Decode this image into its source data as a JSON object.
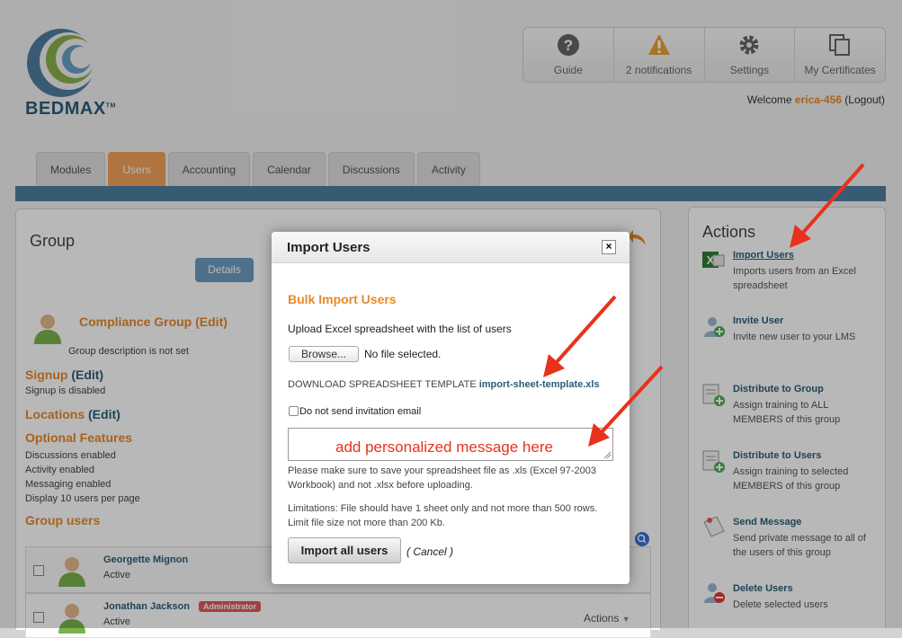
{
  "logo": {
    "text": "BEDMAX",
    "tm": "TM"
  },
  "topnav": [
    {
      "label": "Guide",
      "icon": "question-icon"
    },
    {
      "label": "2 notifications",
      "icon": "warning-icon"
    },
    {
      "label": "Settings",
      "icon": "gear-icon"
    },
    {
      "label": "My Certificates",
      "icon": "certificates-icon"
    }
  ],
  "welcome": {
    "prefix": "Welcome ",
    "user": "erica-456",
    "logout": "(Logout)"
  },
  "tabs": [
    "Modules",
    "Users",
    "Accounting",
    "Calendar",
    "Discussions",
    "Activity"
  ],
  "active_tab": "Users",
  "group": {
    "title": "Group",
    "details_button": "Details",
    "name": "Compliance Group",
    "edit": "(Edit)",
    "description": "Group description is not set",
    "signup_title": "Signup",
    "signup_edit": "(Edit)",
    "signup_status": "Signup is disabled",
    "locations_title": "Locations",
    "locations_edit": "(Edit)",
    "optional_title": "Optional Features",
    "features": [
      "Discussions enabled",
      "Activity enabled",
      "Messaging enabled",
      "Display 10 users per page"
    ],
    "users_title": "Group users",
    "users": [
      {
        "name": "Georgette Mignon",
        "status": "Active",
        "badge": ""
      },
      {
        "name": "Jonathan Jackson",
        "status": "Active",
        "badge": "Administrator"
      }
    ],
    "row_actions": "Actions"
  },
  "actions": {
    "title": "Actions",
    "items": [
      {
        "title": "Import Users",
        "desc": "Imports users from an Excel spreadsheet",
        "icon": "excel-icon"
      },
      {
        "title": "Invite User",
        "desc": "Invite new user to your LMS",
        "icon": "invite-user-icon"
      },
      {
        "title": "Distribute to Group",
        "desc": "Assign training to ALL MEMBERS of this group",
        "icon": "distribute-group-icon"
      },
      {
        "title": "Distribute to Users",
        "desc": "Assign training to selected MEMBERS of this group",
        "icon": "distribute-users-icon"
      },
      {
        "title": "Send Message",
        "desc": "Send private message to all of the users of this group",
        "icon": "message-icon"
      },
      {
        "title": "Delete Users",
        "desc": "Delete selected users",
        "icon": "delete-users-icon"
      }
    ]
  },
  "modal": {
    "title": "Import Users",
    "close": "×",
    "subtitle": "Bulk Import Users",
    "upload_label": "Upload Excel spreadsheet with the list of users",
    "browse_button": "Browse...",
    "file_status": "No file selected.",
    "template_label": "DOWNLOAD SPREADSHEET TEMPLATE",
    "template_link": "import-sheet-template.xls",
    "checkbox_label": "Do not send invitation email",
    "message_placeholder": "add personalized message here",
    "note1a": "Please make sure to save your spreadsheet file as .xls (Excel 97-2003",
    "note1b": "Workbook) and not .xlsx before uploading.",
    "note2a": "Limitations: File should have 1 sheet only and not more than 500 rows.",
    "note2b": "Limit file size not more than 200 Kb.",
    "import_button": "Import all users",
    "cancel": "( Cancel )"
  },
  "colors": {
    "accent_orange": "#e58a2b",
    "brand_blue": "#2b5d78",
    "arrow_red": "#e8321c"
  }
}
